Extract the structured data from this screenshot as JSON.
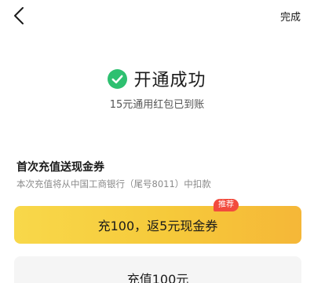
{
  "nav": {
    "back_icon": "chevron-left-icon",
    "done_label": "完成"
  },
  "success": {
    "icon": "check-circle-icon",
    "icon_color": "#2ec070",
    "title": "开通成功",
    "subtitle": "15元通用红包已到账"
  },
  "recharge": {
    "section_title": "首次充值送现金券",
    "section_desc": "本次充值将从中国工商银行（尾号8011）中扣款",
    "options": [
      {
        "label": "充100，返5元现金券",
        "badge": "推荐",
        "accent": "#f6c93a",
        "badge_color": "#f24b3d"
      },
      {
        "label": "充值100元"
      }
    ]
  }
}
